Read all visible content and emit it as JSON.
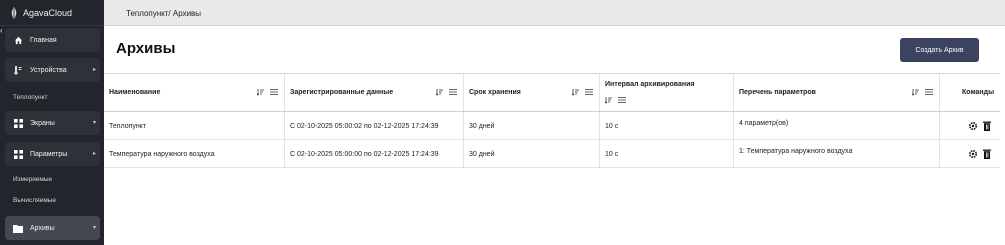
{
  "app": {
    "name": "AgavaCloud"
  },
  "sidebar": {
    "items": [
      {
        "label": "Главная",
        "icon": "home-icon"
      },
      {
        "label": "Устройства",
        "icon": "thermometer-icon"
      },
      {
        "label": "Экраны",
        "icon": "grid-icon"
      },
      {
        "label": "Параметры",
        "icon": "grid-icon"
      },
      {
        "label": "Архивы",
        "icon": "folder-icon"
      }
    ],
    "sub": {
      "teplopunkt": "Теплопункт",
      "measured": "Измеряемые",
      "computed": "Вычисляемые"
    }
  },
  "header": {
    "breadcrumb": "Теплопункт/ Архивы"
  },
  "main": {
    "title": "Архивы",
    "create_label": "Создать Архив",
    "columns": [
      "Наименование",
      "Зарегистрированные данные",
      "Срок хранения",
      "Интервал архивирования",
      "Перечень параметров",
      "Команды"
    ],
    "rows": [
      [
        "Теплопункт",
        "С 02-10-2025 05:00:02 по 02-12-2025 17:24:39",
        "30 дней",
        "10 с",
        "4 параметр(ов)"
      ],
      [
        "Температура наружного воздуха",
        "С 02-10-2025 05:00:00 по 02-12-2025 17:24:39",
        "30 дней",
        "10 с",
        "1: Температура наружного воздуха"
      ]
    ]
  },
  "colors": {
    "sidebar_bg": "#22252b",
    "accent_button": "#3b4360",
    "topbar_bg": "#e9e9ec"
  }
}
